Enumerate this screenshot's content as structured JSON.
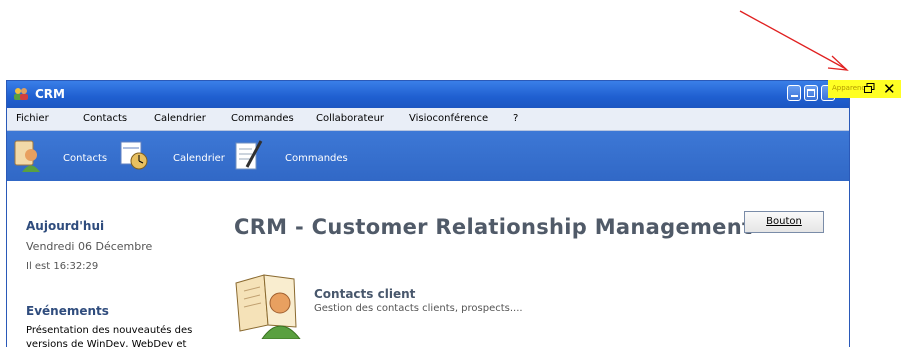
{
  "window": {
    "title": "CRM",
    "accent": "#1f5fd0"
  },
  "menu": {
    "items": [
      "Fichier",
      "Contacts",
      "Calendrier",
      "Commandes",
      "Collaborateur",
      "Visioconférence",
      "?"
    ]
  },
  "toolbar": {
    "items": [
      {
        "label": "Contacts",
        "icon": "contact-person-icon"
      },
      {
        "label": "Calendrier",
        "icon": "calendar-clock-icon"
      },
      {
        "label": "Commandes",
        "icon": "orders-pen-icon"
      }
    ]
  },
  "sidebar": {
    "today_title": "Aujourd'hui",
    "date": "Vendredi 06 Décembre",
    "time": "Il est 16:32:29",
    "events_title": "Evénements",
    "events_text": "Présentation des nouveautés des versions de WinDev, WebDev et"
  },
  "main": {
    "title": "CRM - Customer Relationship Management",
    "button_label": "Bouton",
    "contacts_title": "Contacts client",
    "contacts_subtitle": "Gestion des contacts clients, prospects...."
  },
  "pin_widget": {
    "text": "Apparence",
    "background": "#ffff24"
  },
  "annotation": {
    "arrow_color": "#e02020"
  }
}
